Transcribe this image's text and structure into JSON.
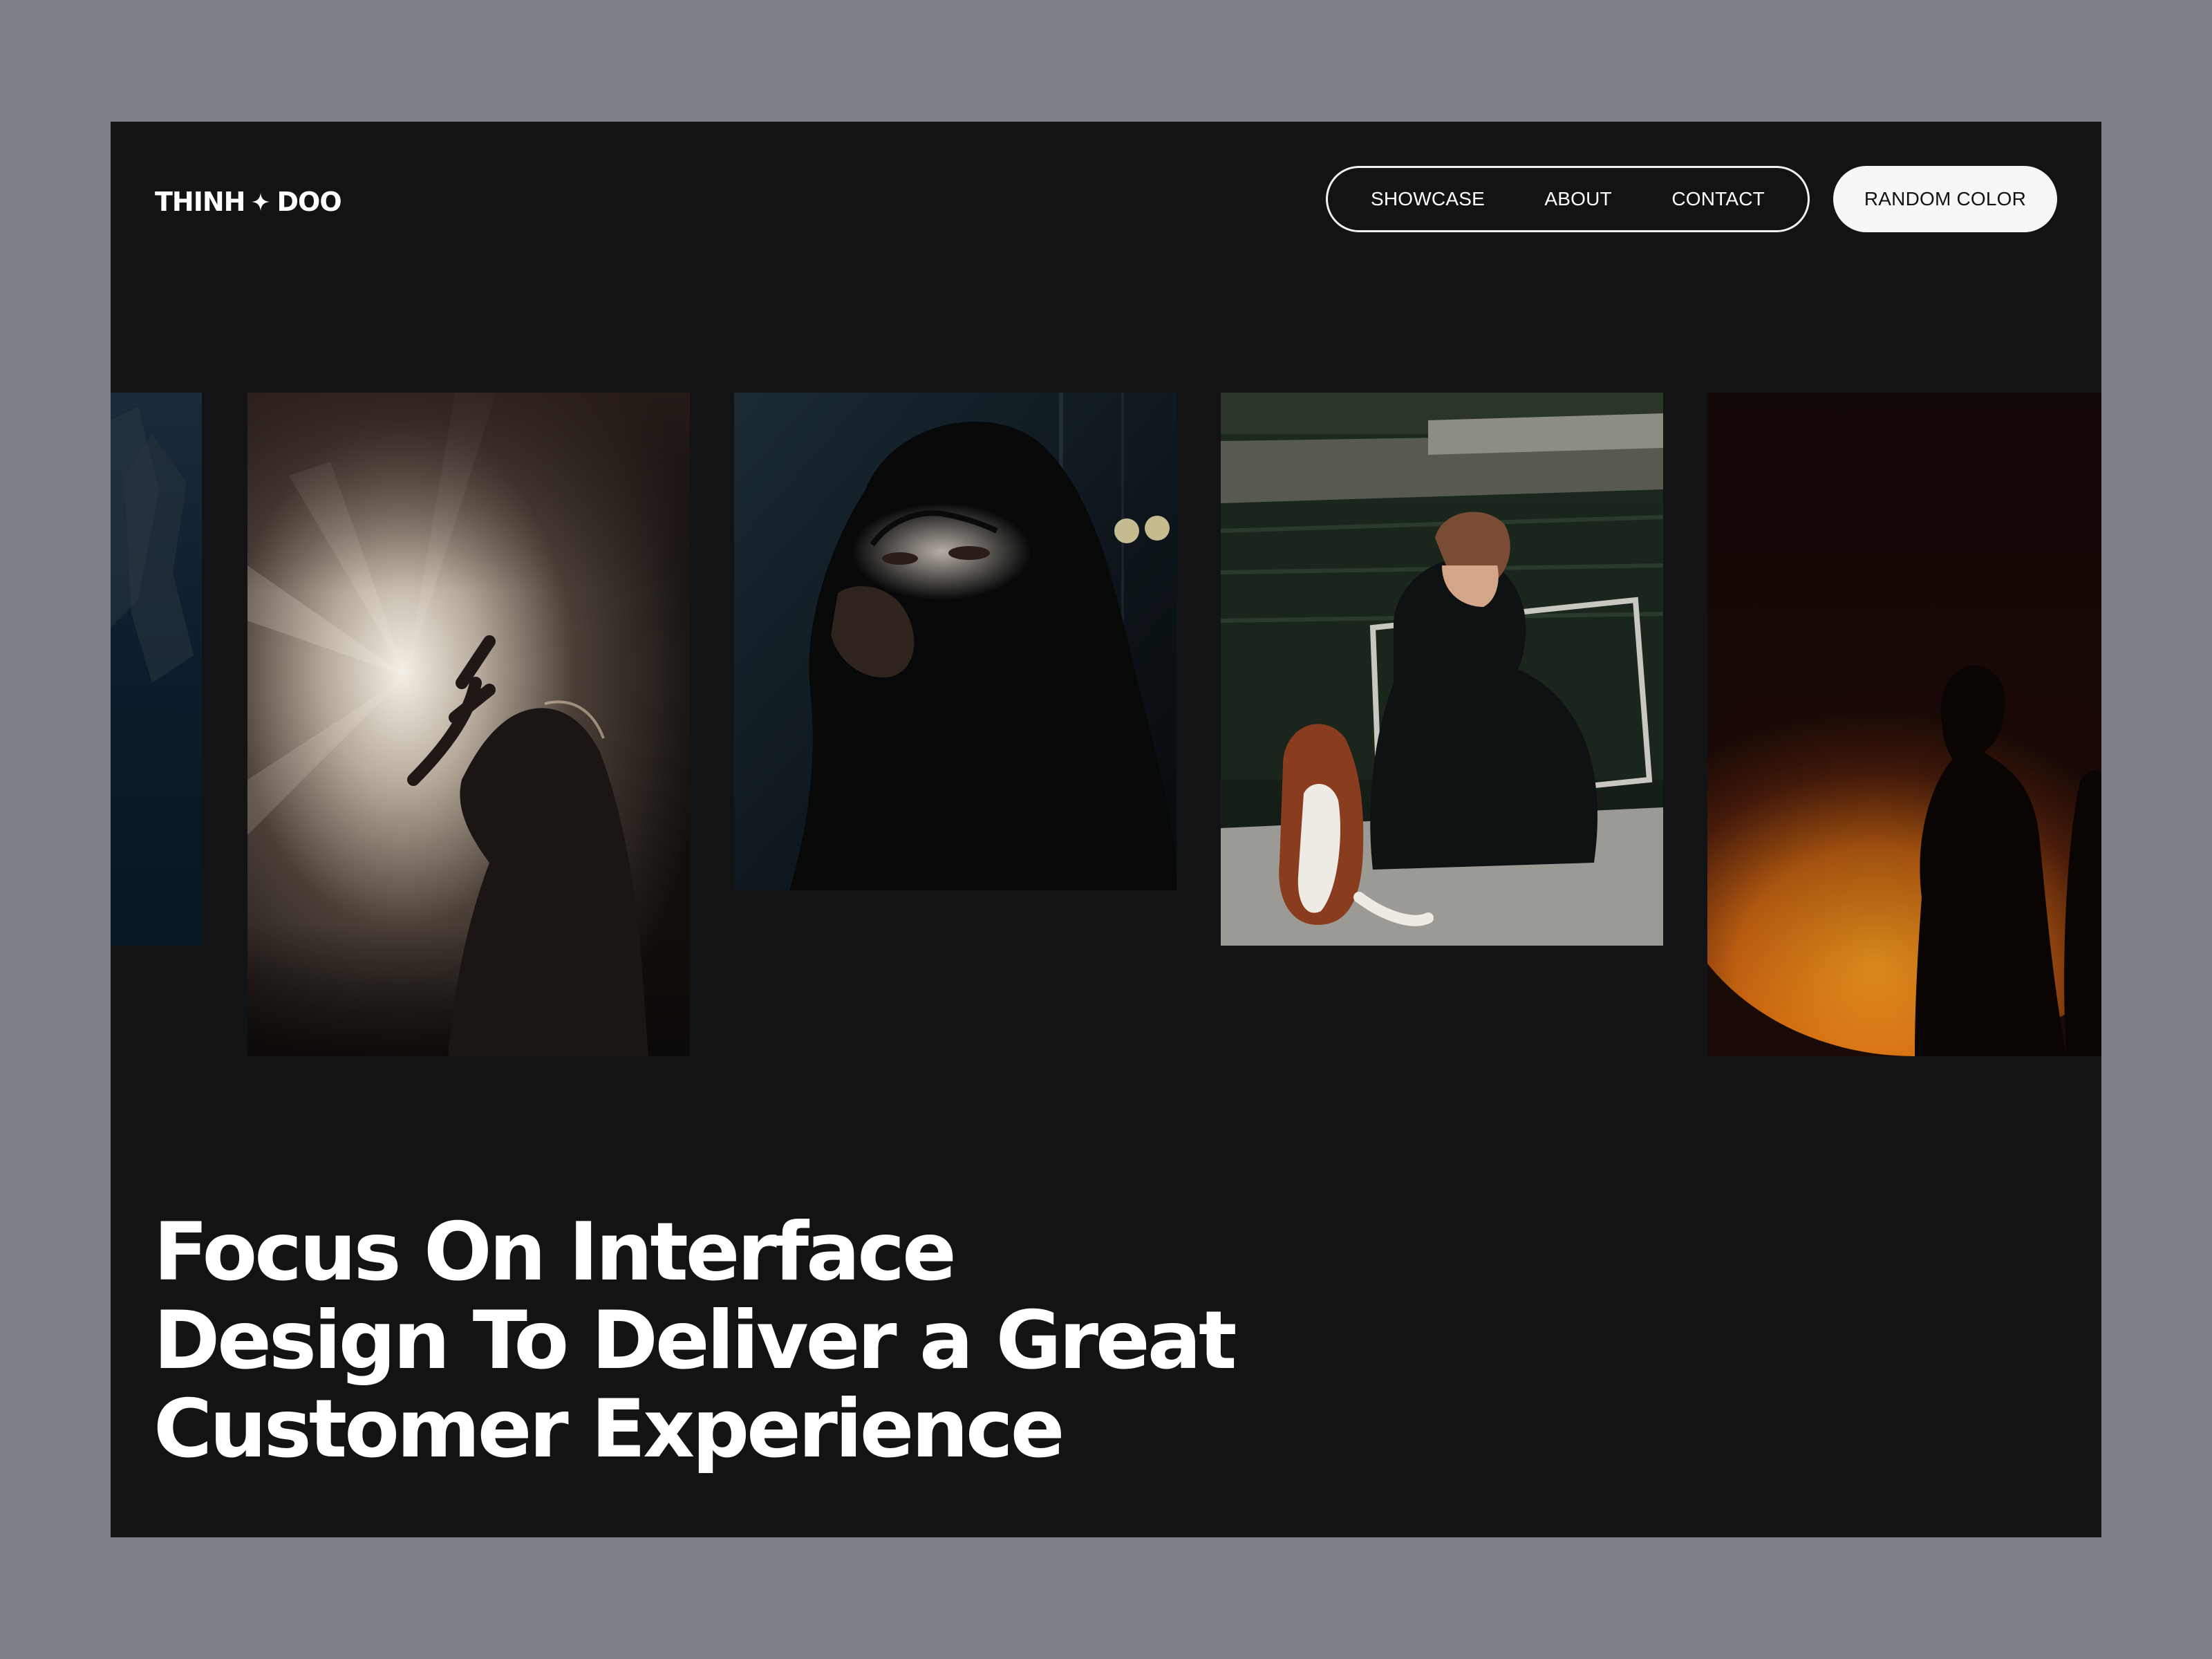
{
  "header": {
    "logo_left": "THINH",
    "logo_right": "DOO",
    "nav": [
      "SHOWCASE",
      "ABOUT",
      "CONTACT"
    ],
    "random_color_label": "RANDOM COLOR"
  },
  "gallery": {
    "photos": [
      "dark-blue-partial-photo",
      "woman-in-light-rays-photo",
      "woman-with-light-on-eyes-photo",
      "man-and-dog-by-water-photo",
      "silhouette-orange-light-photo"
    ]
  },
  "hero": {
    "lines": [
      "Focus On Interface",
      "Design To Deliver a Great",
      "Customer Experience"
    ]
  },
  "colors": {
    "page_background": "#7d828a",
    "frame_background": "#121315",
    "text": "#ffffff",
    "button_background": "#f7f7f7"
  }
}
